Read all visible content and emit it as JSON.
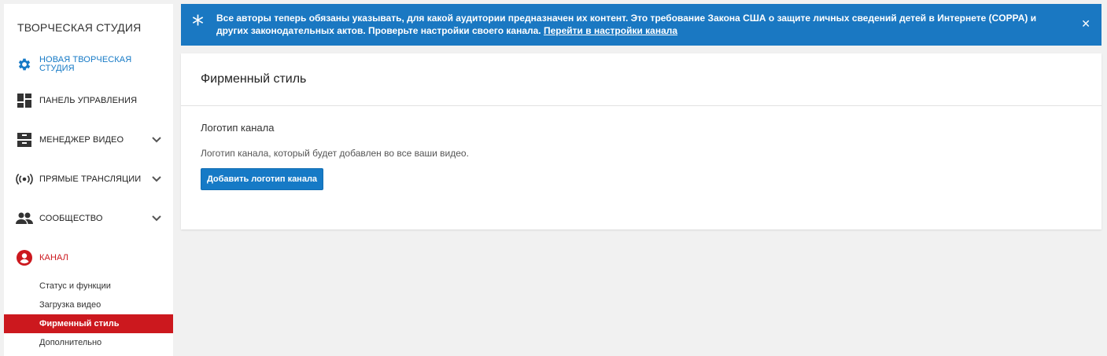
{
  "sidebar": {
    "title": "ТВОРЧЕСКАЯ СТУДИЯ",
    "items": [
      {
        "label": "НОВАЯ ТВОРЧЕСКАЯ СТУДИЯ",
        "icon": "gear-icon",
        "color": "#167ac6"
      },
      {
        "label": "ПАНЕЛЬ УПРАВЛЕНИЯ",
        "icon": "dashboard-icon"
      },
      {
        "label": "МЕНЕДЖЕР ВИДЕО",
        "icon": "video-manager-icon",
        "expandable": true
      },
      {
        "label": "ПРЯМЫЕ ТРАНСЛЯЦИИ",
        "icon": "live-broadcast-icon",
        "expandable": true
      },
      {
        "label": "СООБЩЕСТВО",
        "icon": "community-icon",
        "expandable": true
      },
      {
        "label": "КАНАЛ",
        "icon": "channel-icon",
        "color": "#cc181e"
      }
    ],
    "subitems": [
      {
        "label": "Статус и функции"
      },
      {
        "label": "Загрузка видео"
      },
      {
        "label": "Фирменный стиль",
        "active": true
      },
      {
        "label": "Дополнительно"
      }
    ]
  },
  "banner": {
    "text": "Все авторы теперь обязаны указывать, для какой аудитории предназначен их контент. Это требование Закона США о защите личных сведений детей в Интернете (COPPA) и других законодательных актов. Проверьте настройки своего канала.",
    "link": "Перейти в настройки канала",
    "color": "#1a78c2"
  },
  "card": {
    "title": "Фирменный стиль",
    "section_title": "Логотип канала",
    "section_desc": "Логотип канала, который будет добавлен во все ваши видео.",
    "button": "Добавить логотип канала"
  },
  "colors": {
    "accent": "#167ac6",
    "active": "#cc181e",
    "background": "#f1f1f1"
  }
}
